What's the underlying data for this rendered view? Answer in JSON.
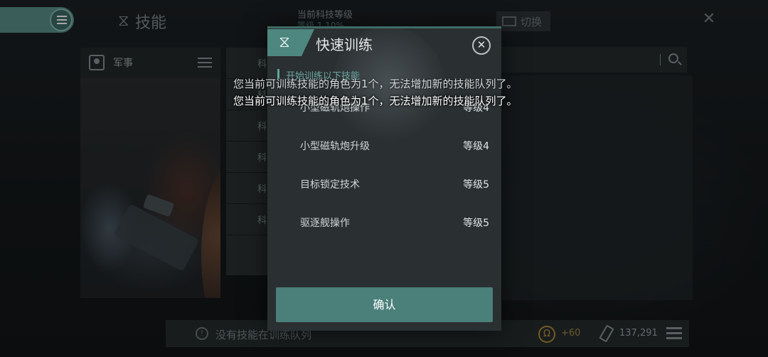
{
  "header": {
    "title": "技能",
    "tech_level_label": "当前科技等级",
    "tech_level_value": "等级 1   10%",
    "switch_label": "切换"
  },
  "sidebar": {
    "category_label": "军事",
    "list_items": [
      "科",
      "科",
      "科",
      "科",
      "科",
      "科"
    ]
  },
  "bottom_bar": {
    "status_text": "没有技能在训练队列",
    "omega_value": "+60",
    "skill_points": "137,291"
  },
  "dialog": {
    "title": "快速训练",
    "subtitle": "开始训练以下技能",
    "skills": [
      {
        "name": "小型磁轨炮操作",
        "level": "等级4"
      },
      {
        "name": "小型磁轨炮升级",
        "level": "等级4"
      },
      {
        "name": "目标锁定技术",
        "level": "等级5"
      },
      {
        "name": "驱逐舰操作",
        "level": "等级5"
      }
    ],
    "confirm_label": "确认"
  },
  "toasts": [
    "您当前可训练技能的角色为1个，无法增加新的技能队列了。",
    "您当前可训练技能的角色为1个，无法增加新的技能队列了。"
  ],
  "colors": {
    "accent": "#4b807a",
    "accent_light": "#6da79f",
    "omega_gold": "#c49a42"
  }
}
